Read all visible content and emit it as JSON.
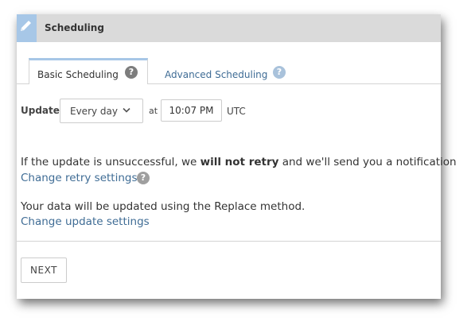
{
  "header": {
    "title": "Scheduling",
    "icon": "pencil-icon"
  },
  "tabs": [
    {
      "label": "Basic Scheduling",
      "active": true
    },
    {
      "label": "Advanced Scheduling",
      "active": false
    }
  ],
  "update": {
    "label": "Update",
    "frequency": "Every day",
    "at_label": "at",
    "time": "10:07 PM",
    "timezone": "UTC"
  },
  "retry": {
    "text_before": "If the update is unsuccessful, we ",
    "text_bold": "will not retry",
    "text_after": " and we'll send you a notification",
    "link": "Change retry settings"
  },
  "method": {
    "text": "Your data will be updated using the Replace method.",
    "link": "Change update settings"
  },
  "footer": {
    "next_label": "NEXT"
  },
  "colors": {
    "accent": "#a7c7e7",
    "link": "#3f6c95",
    "header_bg": "#dadada"
  }
}
